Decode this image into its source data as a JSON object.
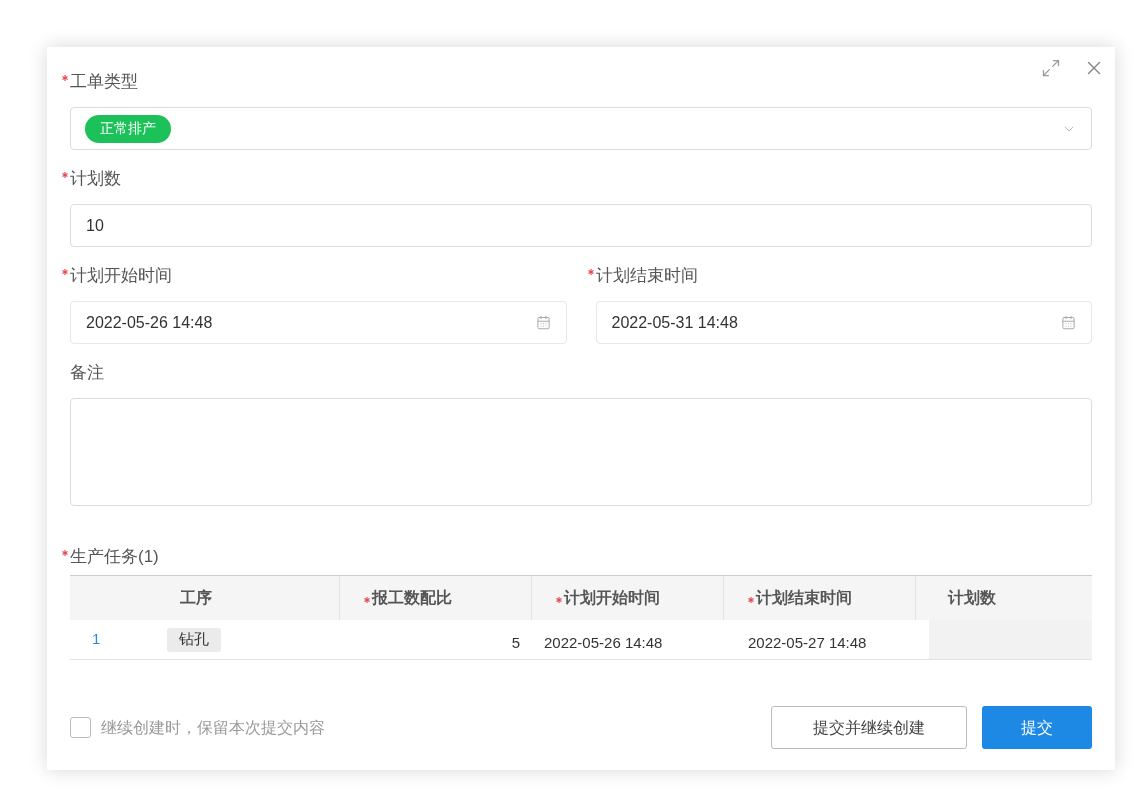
{
  "form_rows": [
    [
      {
        "kind": "tag-select",
        "label": "工单类型",
        "required": true,
        "tag": {
          "text": "正常排产",
          "color": "#1cc15a"
        }
      }
    ],
    [
      {
        "kind": "input",
        "label": "计划数",
        "required": true,
        "value": "10"
      }
    ],
    [
      {
        "kind": "date",
        "label": "计划开始时间",
        "required": true,
        "value": "2022-05-26 14:48"
      },
      {
        "kind": "date",
        "label": "计划结束时间",
        "required": true,
        "value": "2022-05-31 14:48"
      }
    ],
    [
      {
        "kind": "textarea",
        "label": "备注",
        "required": false
      }
    ]
  ],
  "tasks": {
    "label": "生产任务(1)",
    "required": true,
    "columns": [
      {
        "label": "工序",
        "required": false
      },
      {
        "label": "报工数配比",
        "required": true
      },
      {
        "label": "计划开始时间",
        "required": true
      },
      {
        "label": "计划结束时间",
        "required": true
      },
      {
        "label": "计划数",
        "required": false
      }
    ],
    "rows": [
      {
        "index": "1",
        "process": "钻孔",
        "ratio": "5",
        "start": "2022-05-26 14:48",
        "end": "2022-05-27 14:48",
        "count_disabled": true
      }
    ]
  },
  "keep_content": {
    "label": "继续创建时，保留本次提交内容",
    "checked": false
  },
  "buttons": [
    {
      "label": "提交并继续创建",
      "kind": "secondary"
    },
    {
      "label": "提交",
      "kind": "primary"
    }
  ]
}
